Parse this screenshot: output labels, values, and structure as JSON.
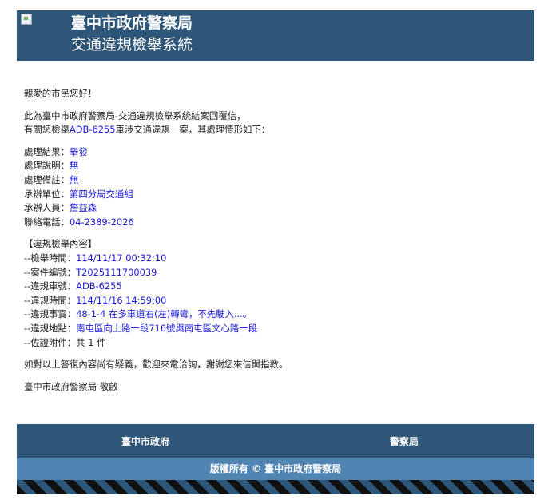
{
  "header": {
    "org": "臺中市政府警察局",
    "system": "交通違規檢舉系統"
  },
  "greeting": "親愛的市民您好！",
  "intro": {
    "line1": "此為臺中市政府警察局-交通違規檢舉系統結案回覆信，",
    "line2_prefix": "有關您檢舉",
    "plate": "ADB-6255",
    "line2_suffix": "車涉交通違規一案，其處理情形如下："
  },
  "result": [
    {
      "label": "處理結果：",
      "value": "舉發"
    },
    {
      "label": "處理說明：",
      "value": "無"
    },
    {
      "label": "處理備註：",
      "value": "無"
    },
    {
      "label": "承辦單位：",
      "value": "第四分局交通組"
    },
    {
      "label": "承辦人員：",
      "value": "詹益森"
    },
    {
      "label": "聯絡電話：",
      "value": "04-2389-2026"
    }
  ],
  "report": {
    "heading": "【違規檢舉內容】",
    "items": [
      {
        "label": "--檢舉時間：",
        "value": "114/11/17 00:32:10"
      },
      {
        "label": "--案件編號：",
        "value": "T2025111700039"
      },
      {
        "label": "--違規車號：",
        "value": "ADB-6255"
      },
      {
        "label": "--違規時間：",
        "value": "114/11/16 14:59:00"
      },
      {
        "label": "--違規事實：",
        "value": "48-1-4 在多車道右(左)轉彎，不先駛入...。"
      },
      {
        "label": "--違規地點：",
        "value": "南屯區向上路一段716號與南屯區文心路一段"
      },
      {
        "label": "--佐證附件：",
        "value": "共 1 件",
        "plain": true
      }
    ]
  },
  "closing": "如對以上答復內容尚有疑義，歡迎來電洽詢，謝謝您來信與指教。",
  "signature": "臺中市政府警察局 敬啟",
  "footer": {
    "left": "臺中市政府",
    "right": "警察局",
    "copyright": "版權所有 © 臺中市政府警察局"
  }
}
